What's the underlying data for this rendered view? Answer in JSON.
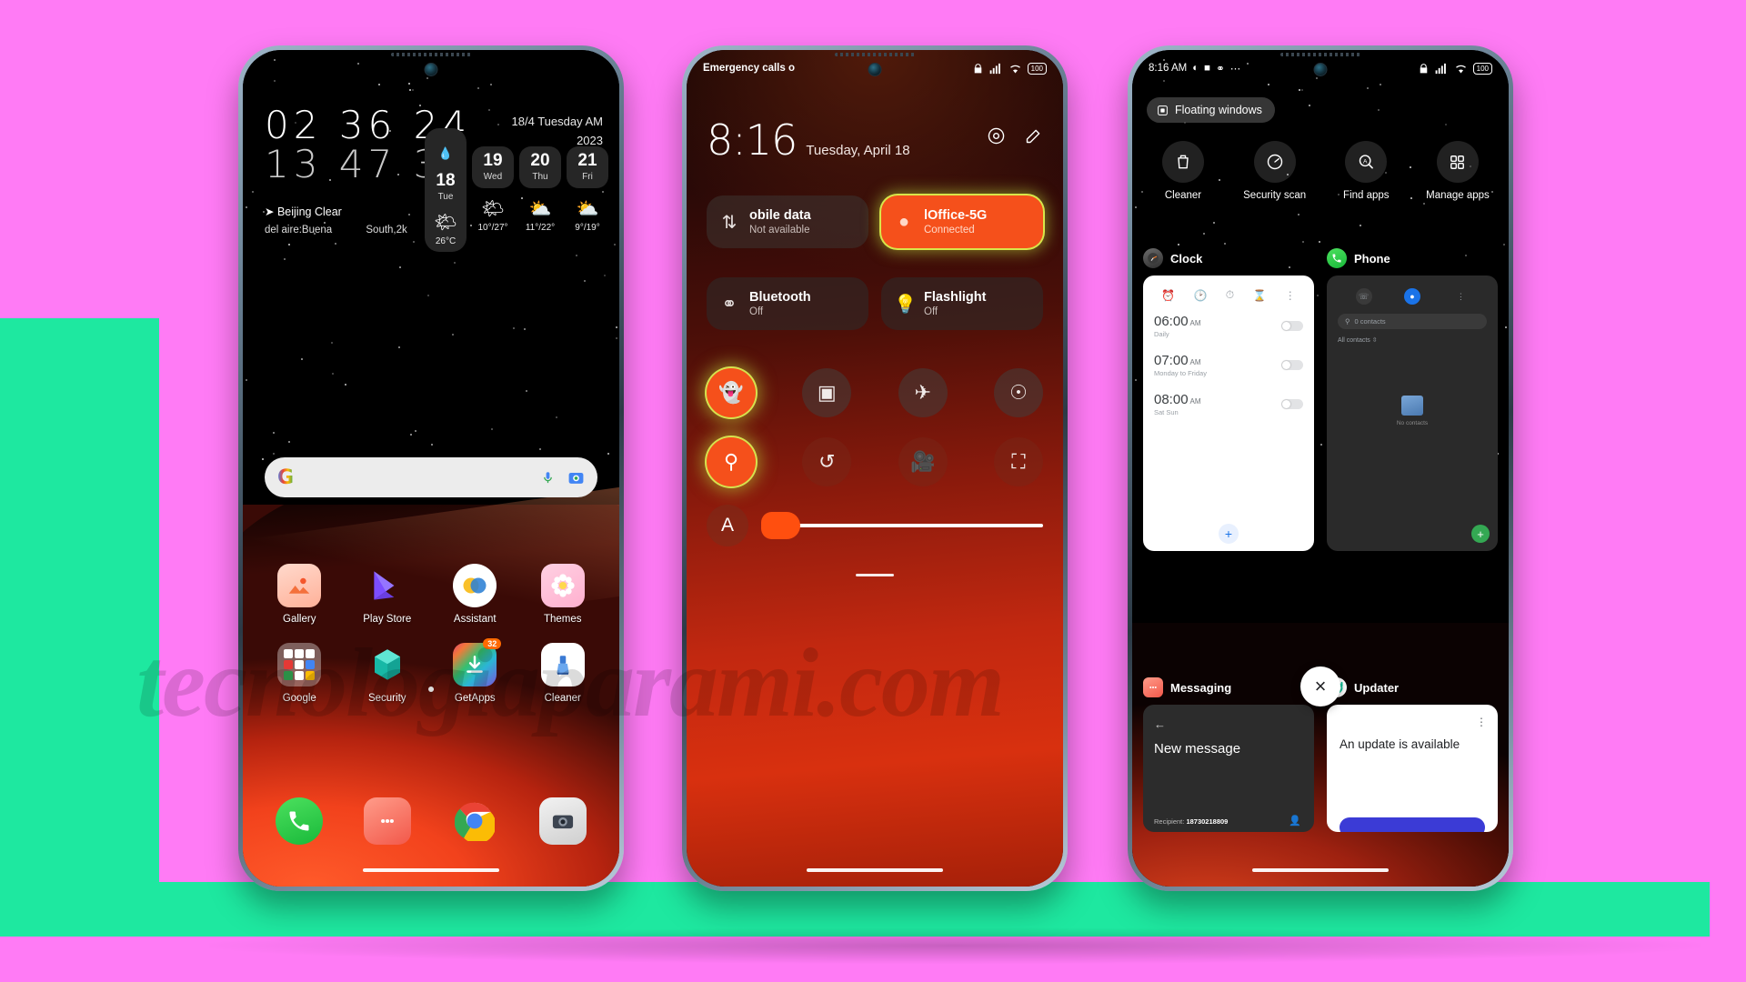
{
  "watermark": "tecnologiaparami.com",
  "phone1": {
    "name": "home-screen",
    "clock": {
      "row1": "02 36 24",
      "row2": "13 47 35"
    },
    "date": {
      "line1": "18/4 Tuesday AM",
      "line2": "2023"
    },
    "weather_line1": "Beijing  Clear",
    "weather_line2a": "del aire:Buena",
    "weather_line2b": "South,2k",
    "forecast": [
      {
        "day": "18",
        "dow": "Tue",
        "icon": "sun-cloud-icon",
        "temp": "26°C",
        "selected": true
      },
      {
        "day": "19",
        "dow": "Wed",
        "icon": "sun-cloud-icon",
        "temp": "10°/27°",
        "selected": false
      },
      {
        "day": "20",
        "dow": "Thu",
        "icon": "cloud-sun-icon",
        "temp": "11°/22°",
        "selected": false
      },
      {
        "day": "21",
        "dow": "Fri",
        "icon": "cloud-sun-icon",
        "temp": "9°/19°",
        "selected": false
      }
    ],
    "search": {
      "logo": "google-logo-icon",
      "mic": "microphone-icon",
      "lens": "google-lens-icon"
    },
    "apps_row1": [
      {
        "label": "Gallery",
        "icon": "gallery-icon"
      },
      {
        "label": "Play Store",
        "icon": "play-store-icon"
      },
      {
        "label": "Assistant",
        "icon": "assistant-icon"
      },
      {
        "label": "Themes",
        "icon": "themes-icon"
      }
    ],
    "apps_row2": [
      {
        "label": "Google",
        "icon": "google-folder-icon",
        "badge": ""
      },
      {
        "label": "Security",
        "icon": "security-icon",
        "badge": ""
      },
      {
        "label": "GetApps",
        "icon": "getapps-icon",
        "badge": "32"
      },
      {
        "label": "Cleaner",
        "icon": "cleaner-icon",
        "badge": ""
      }
    ],
    "dock": [
      {
        "label": "Phone",
        "icon": "phone-icon"
      },
      {
        "label": "Messaging",
        "icon": "messaging-icon"
      },
      {
        "label": "Chrome",
        "icon": "chrome-icon"
      },
      {
        "label": "Camera",
        "icon": "camera-icon"
      }
    ]
  },
  "phone2": {
    "name": "quick-settings-panel",
    "status_left": "Emergency calls o",
    "status_right_icons": [
      "lock-icon",
      "signal-icon",
      "wifi-icon",
      "battery-100-icon"
    ],
    "clock_time": "8:16",
    "clock_date": "Tuesday, April 18",
    "header_icons": [
      "settings-gear-icon",
      "edit-pencil-icon"
    ],
    "big_tiles": [
      {
        "title": "obile data",
        "sub": "Not available",
        "icon": "data-transfer-icon",
        "active": false
      },
      {
        "title": "lOffice-5G",
        "sub": "Connected",
        "icon": "wifi-drop-icon",
        "active": true
      },
      {
        "title": "Bluetooth",
        "sub": "Off",
        "icon": "earbud-icon",
        "active": false
      },
      {
        "title": "Flashlight",
        "sub": "Off",
        "icon": "flashlight-icon",
        "active": false
      }
    ],
    "toggles_row1": [
      {
        "name": "silent-ghost-icon",
        "glyph": "●",
        "state": "on"
      },
      {
        "name": "screenshot-icon",
        "glyph": "▣",
        "state": "off"
      },
      {
        "name": "airplane-mode-icon",
        "glyph": "✈",
        "state": "off"
      },
      {
        "name": "fingerprint-icon",
        "glyph": "ʘ",
        "state": "off"
      }
    ],
    "toggles_row2": [
      {
        "name": "location-icon",
        "glyph": "◎",
        "state": "on"
      },
      {
        "name": "auto-rotate-icon",
        "glyph": "↻",
        "state": "off"
      },
      {
        "name": "screen-record-icon",
        "glyph": "▶",
        "state": "off"
      },
      {
        "name": "scanner-icon",
        "glyph": "⬚",
        "state": "off"
      }
    ],
    "brightness": {
      "auto_label": "A",
      "value_percent": 6
    }
  },
  "phone3": {
    "name": "recent-apps",
    "status_time": "8:16 AM",
    "status_left_icons": [
      "contrast-icon",
      "square-icon",
      "drop-icon",
      "more-dots-icon"
    ],
    "status_right_icons": [
      "lock-icon",
      "signal-icon",
      "wifi-icon",
      "battery-100-icon"
    ],
    "floating_windows_label": "Floating windows",
    "shortcuts": [
      {
        "label": "Cleaner",
        "icon": "trash-icon"
      },
      {
        "label": "Security scan",
        "icon": "gauge-icon"
      },
      {
        "label": "Find apps",
        "icon": "search-a-icon"
      },
      {
        "label": "Manage apps",
        "icon": "grid-apps-icon"
      }
    ],
    "cards": [
      {
        "app": "Clock",
        "icon": "clock-icon",
        "tabs": [
          "alarm-tab",
          "clock-tab",
          "stopwatch-tab",
          "timer-tab",
          "overflow-menu"
        ],
        "alarms": [
          {
            "time": "06:00",
            "ampm": "AM",
            "repeat": "Daily"
          },
          {
            "time": "07:00",
            "ampm": "AM",
            "repeat": "Monday to Friday"
          },
          {
            "time": "08:00",
            "ampm": "AM",
            "repeat": "Sat Sun"
          }
        ],
        "fab": "add-alarm-button"
      },
      {
        "app": "Phone",
        "icon": "phone-icon",
        "search_placeholder": "0 contacts",
        "filter_label": "All contacts",
        "empty_text": "No contacts",
        "fab": "add-contact-button"
      },
      {
        "app": "Messaging",
        "icon": "messaging-icon",
        "title": "New message",
        "recipient_label": "Recipient:",
        "recipient_value": "18730218809"
      },
      {
        "app": "Updater",
        "icon": "updater-icon",
        "title": "An update is available"
      }
    ],
    "close_label": "×"
  }
}
